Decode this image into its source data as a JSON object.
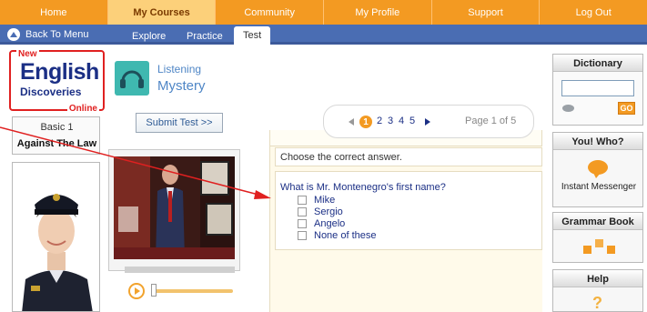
{
  "nav": {
    "items": [
      {
        "label": "Home",
        "active": false
      },
      {
        "label": "My Courses",
        "active": true
      },
      {
        "label": "Community",
        "active": false
      },
      {
        "label": "My Profile",
        "active": false
      },
      {
        "label": "Support",
        "active": false
      },
      {
        "label": "Log Out",
        "active": false
      }
    ]
  },
  "subnav": {
    "back_label": "Back To Menu",
    "tabs": [
      {
        "label": "Explore"
      },
      {
        "label": "Practice"
      },
      {
        "label": "Test",
        "active": true
      }
    ]
  },
  "logo": {
    "new": "New",
    "english": "English",
    "discoveries": "Discoveries",
    "online": "Online"
  },
  "lesson": {
    "skill": "Listening",
    "title": "Mystery",
    "level": "Basic 1",
    "unit": "Against The Law"
  },
  "submit_label": "Submit Test >>",
  "pager": {
    "pages": [
      "1",
      "2",
      "3",
      "4",
      "5"
    ],
    "current_page": 1,
    "page_label": "Page 1 of 5"
  },
  "question": {
    "instruction": "Choose the correct answer.",
    "text": "What is Mr. Montenegro's first name?",
    "options": [
      "Mike",
      "Sergio",
      "Angelo",
      "None of these"
    ]
  },
  "sidebar": {
    "dictionary": {
      "title": "Dictionary",
      "go": "GO"
    },
    "you_who": {
      "title": "You! Who?",
      "item": "Instant Messenger"
    },
    "grammar": {
      "title": "Grammar Book"
    },
    "help": {
      "title": "Help"
    }
  },
  "colors": {
    "nav_orange": "#f39a22",
    "nav_active": "#fcd07a",
    "subnav_blue": "#4a6db3",
    "text_blue": "#1b2f85",
    "panel_cream": "#fffaea",
    "arrow_red": "#e02020"
  },
  "icons": {
    "back": "up-triangle-circle-icon",
    "listening": "headphones-icon",
    "play": "play-icon",
    "prev": "left-triangle-icon",
    "next": "right-triangle-icon",
    "dictionary": "book-icon",
    "chat": "speech-bubble-icon",
    "grammar": "blocks-icon",
    "help": "question-mark-icon"
  }
}
